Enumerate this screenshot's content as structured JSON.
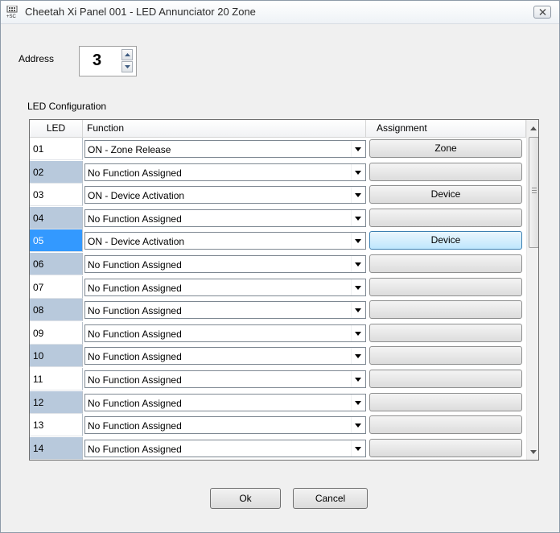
{
  "window": {
    "title": "Cheetah Xi Panel 001 - LED Annunciator 20 Zone",
    "app_icon": "panel-icon",
    "close_icon": "close-icon"
  },
  "address": {
    "label": "Address",
    "value": "3"
  },
  "led_config": {
    "label": "LED Configuration",
    "columns": [
      "LED",
      "Function",
      "Assignment"
    ],
    "rows": [
      {
        "led": "01",
        "function": "ON - Zone Release",
        "assignment": "Zone"
      },
      {
        "led": "02",
        "function": "No Function Assigned",
        "assignment": ""
      },
      {
        "led": "03",
        "function": "ON - Device Activation",
        "assignment": "Device"
      },
      {
        "led": "04",
        "function": "No Function Assigned",
        "assignment": ""
      },
      {
        "led": "05",
        "function": "ON - Device Activation",
        "assignment": "Device"
      },
      {
        "led": "06",
        "function": "No Function Assigned",
        "assignment": ""
      },
      {
        "led": "07",
        "function": "No Function Assigned",
        "assignment": ""
      },
      {
        "led": "08",
        "function": "No Function Assigned",
        "assignment": ""
      },
      {
        "led": "09",
        "function": "No Function Assigned",
        "assignment": ""
      },
      {
        "led": "10",
        "function": "No Function Assigned",
        "assignment": ""
      },
      {
        "led": "11",
        "function": "No Function Assigned",
        "assignment": ""
      },
      {
        "led": "12",
        "function": "No Function Assigned",
        "assignment": ""
      },
      {
        "led": "13",
        "function": "No Function Assigned",
        "assignment": ""
      },
      {
        "led": "14",
        "function": "No Function Assigned",
        "assignment": ""
      }
    ],
    "selected_led": "05"
  },
  "buttons": {
    "ok": "Ok",
    "cancel": "Cancel"
  },
  "colors": {
    "selection": "#3399ff",
    "alt_row": "#b8c9dc"
  }
}
